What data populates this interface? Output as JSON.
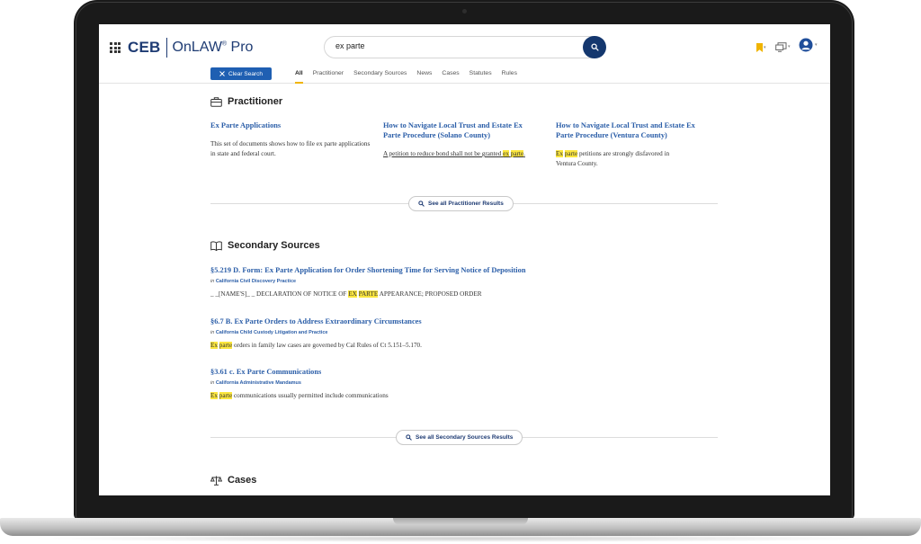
{
  "brand": {
    "ceb": "CEB",
    "onlaw": "OnLAW",
    "reg": "®",
    "pro": "Pro"
  },
  "search": {
    "query": "ex parte",
    "placeholder": ""
  },
  "clear_search_label": "Clear Search",
  "tabs": [
    "All",
    "Practitioner",
    "Secondary Sources",
    "News",
    "Cases",
    "Statutes",
    "Rules"
  ],
  "active_tab": "All",
  "colors": {
    "brand_navy": "#1e3b73",
    "link_blue": "#2b5ea8",
    "highlight": "#fbe63e",
    "accent_gold": "#f0b400",
    "button_blue": "#1f5fb2"
  },
  "practitioner": {
    "title": "Practitioner",
    "icon": "briefcase-icon",
    "results": [
      {
        "title": "Ex Parte Applications",
        "snippet": "This set of documents shows how to file ex parte applications in state and federal court."
      },
      {
        "title_line1": "How to Navigate Local Trust and Estate Ex",
        "title_line2": "Parte Procedure (Solano County)",
        "snippet_pre": "A petition to reduce bond shall not be granted ",
        "snippet_hl1": "ex",
        "snippet_hl2": "parte",
        "snippet_post": "."
      },
      {
        "title_line1": "How to Navigate Local Trust and Estate Ex",
        "title_line2": "Parte Procedure (Ventura County)",
        "snippet_hl1": "Ex",
        "snippet_hl2": "parte",
        "snippet_post": " petitions are strongly disfavored in",
        "snippet_line2": "Ventura County."
      }
    ],
    "see_all": "See all Practitioner Results"
  },
  "secondary": {
    "title": "Secondary Sources",
    "icon": "open-book-icon",
    "in_label": "in",
    "results": [
      {
        "title": "§5.219 D. Form: Ex Parte Application for Order Shortening Time for Serving Notice of Deposition",
        "source": "California Civil Discovery Practice",
        "snippet_pre": "_ _[NAME'S]_ _ DECLARATION OF NOTICE OF ",
        "snippet_hl1": "EX",
        "snippet_hl2": "PARTE",
        "snippet_post": " APPEARANCE; PROPOSED ORDER"
      },
      {
        "title": "§6.7 B. Ex Parte Orders to Address Extraordinary Circumstances",
        "source": "California Child Custody Litigation and Practice",
        "snippet_hl1": "Ex",
        "snippet_hl2": "parte",
        "snippet_post": " orders in family law cases are governed by Cal Rules of Ct 5.151–5.170."
      },
      {
        "title": "§3.61 c. Ex Parte Communications",
        "source": "California Administrative Mandamus",
        "snippet_hl1": "Ex",
        "snippet_hl2": "parte",
        "snippet_post": " communications usually permitted include communications"
      }
    ],
    "see_all": "See all Secondary Sources Results"
  },
  "cases": {
    "title": "Cases",
    "icon": "scales-icon"
  }
}
